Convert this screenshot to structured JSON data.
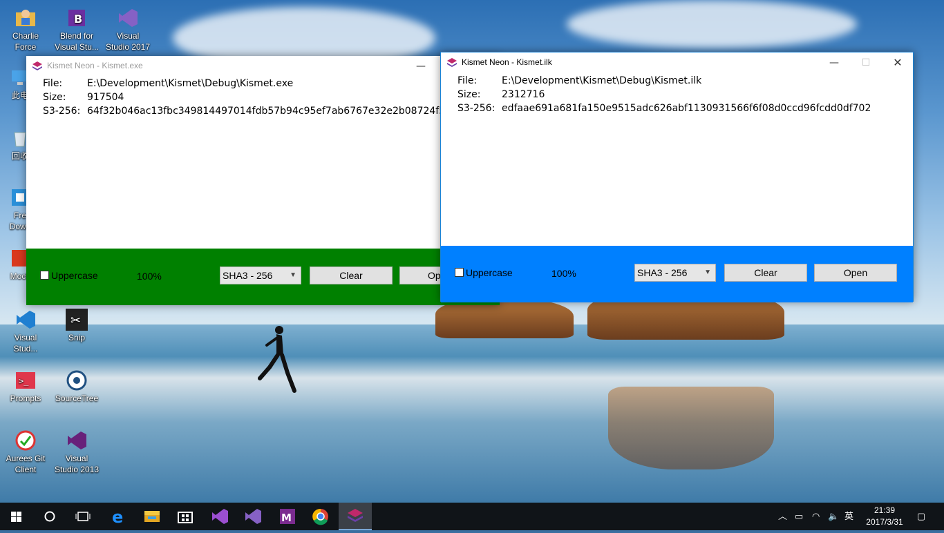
{
  "desktop": {
    "icons": [
      {
        "label": "Charlie\nForce"
      },
      {
        "label": "Blend for\nVisual Stu..."
      },
      {
        "label": "Visual\nStudio 2017"
      },
      {
        "label": "此电"
      },
      {
        "label": "回收"
      },
      {
        "label": "Fre\nDown"
      },
      {
        "label": "Mock"
      },
      {
        "label": "Visual\nStud..."
      },
      {
        "label": "Snip"
      },
      {
        "label": "Prompts"
      },
      {
        "label": "SourceTree"
      },
      {
        "label": "Aurees Git\nClient"
      },
      {
        "label": "Visual\nStudio 2013"
      }
    ]
  },
  "window_left": {
    "title": "Kismet Neon - Kismet.exe",
    "file_label": "File:",
    "file_value": "E:\\Development\\Kismet\\Debug\\Kismet.exe",
    "size_label": "Size:",
    "size_value": "917504",
    "hash_label": "S3-256:",
    "hash_value": "64f32b046ac13fbc349814497014fdb57b94c95ef7ab6767e32e2b08724f57e4",
    "uppercase_label": "Uppercase",
    "progress_text": "100%",
    "algorithm": "SHA3 - 256",
    "clear_label": "Clear",
    "open_label": "Open",
    "panel_color": "#008000"
  },
  "window_right": {
    "title": "Kismet Neon - Kismet.ilk",
    "file_label": "File:",
    "file_value": "E:\\Development\\Kismet\\Debug\\Kismet.ilk",
    "size_label": "Size:",
    "size_value": "2312716",
    "hash_label": "S3-256:",
    "hash_value": "edfaae691a681fa150e9515adc626abf1130931566f6f08d0ccd96fcdd0df702",
    "uppercase_label": "Uppercase",
    "progress_text": "100%",
    "algorithm": "SHA3 - 256",
    "clear_label": "Clear",
    "open_label": "Open",
    "panel_color": "#0080ff"
  },
  "taskbar": {
    "ime": "英",
    "time": "21:39",
    "date": "2017/3/31",
    "items": [
      "start",
      "cortana",
      "task-view",
      "edge",
      "file-explorer",
      "store",
      "visual-studio",
      "visual-studio-2017",
      "macromedia",
      "chrome",
      "kismet-neon"
    ]
  }
}
